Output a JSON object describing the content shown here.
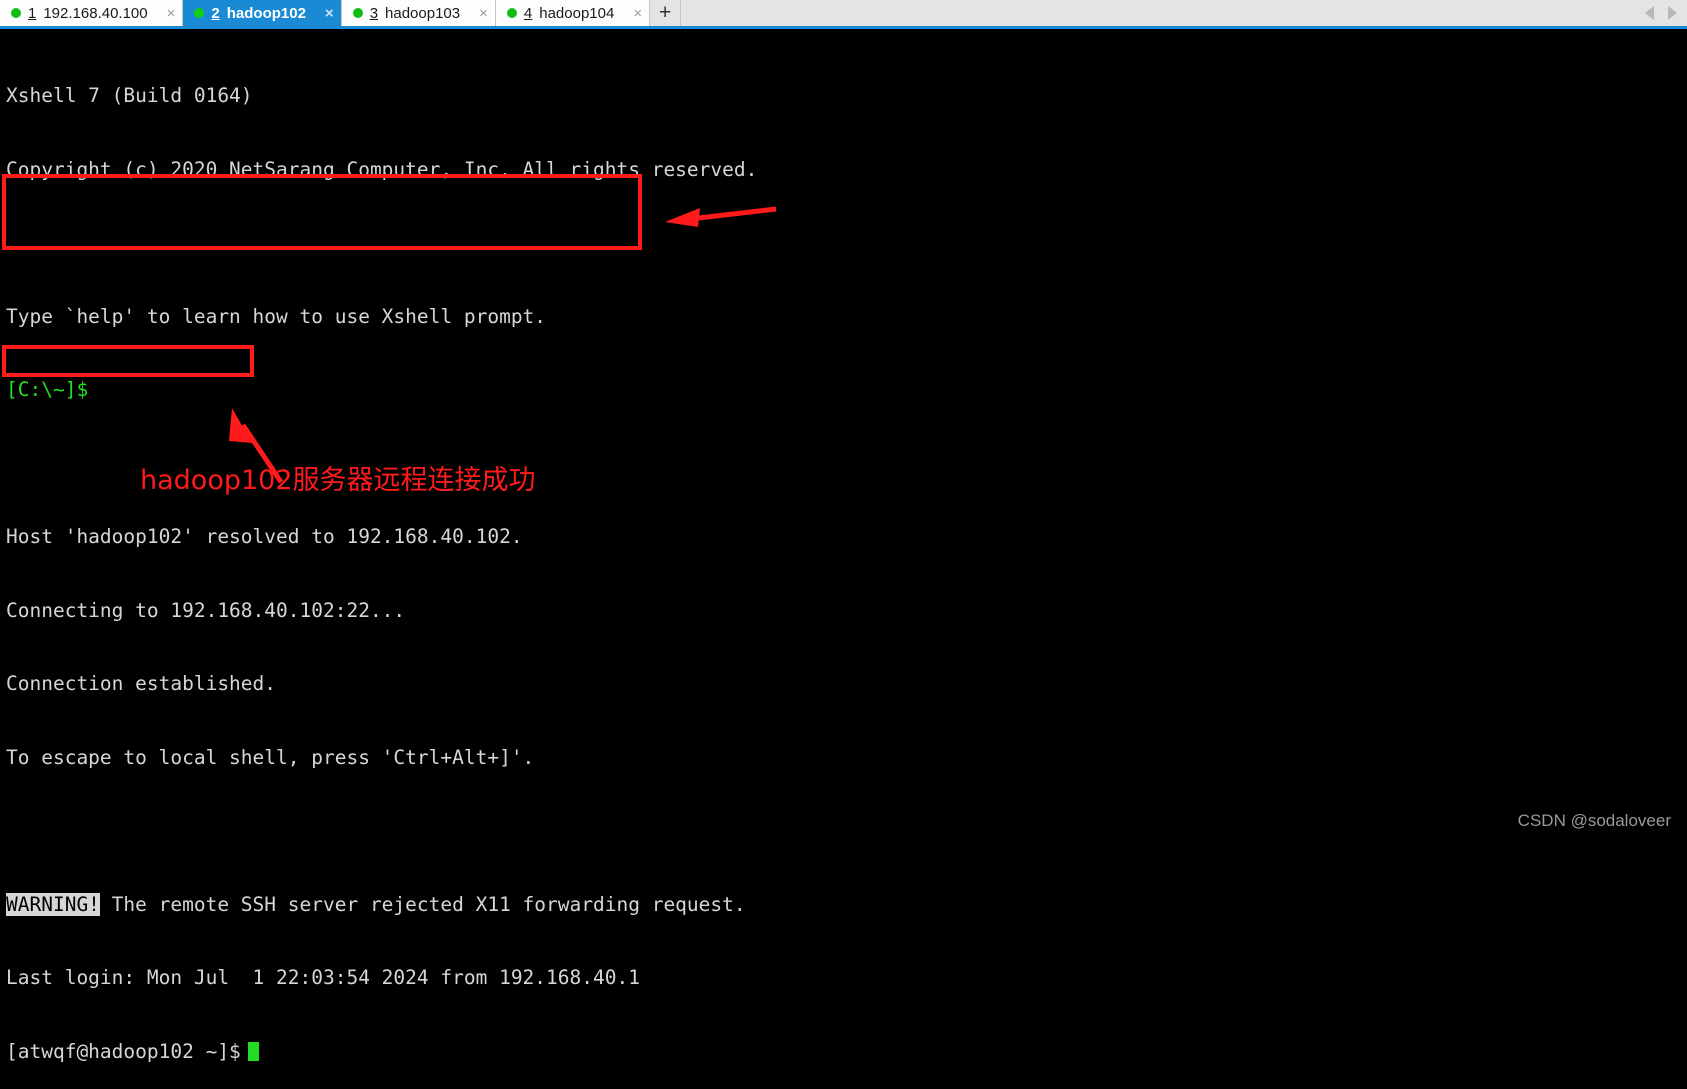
{
  "window": {
    "tabs": [
      {
        "index": "1",
        "label": "192.168.40.100",
        "active": false,
        "status": "connected",
        "close": "×"
      },
      {
        "index": "2",
        "label": "hadoop102",
        "active": true,
        "status": "connected",
        "close": "×"
      },
      {
        "index": "3",
        "label": "hadoop103",
        "active": false,
        "status": "connected",
        "close": "×"
      },
      {
        "index": "4",
        "label": "hadoop104",
        "active": false,
        "status": "connected",
        "close": "×"
      }
    ],
    "new_tab_label": "+",
    "scroll_left_icon": "chevron-left-icon",
    "scroll_right_icon": "chevron-right-icon"
  },
  "terminal": {
    "line_1": "Xshell 7 (Build 0164)",
    "line_2": "Copyright (c) 2020 NetSarang Computer, Inc. All rights reserved.",
    "line_3": "Type `help' to learn how to use Xshell prompt.",
    "line_4_prompt": "[C:\\~]$",
    "line_5": "Host 'hadoop102' resolved to 192.168.40.102.",
    "line_6": "Connecting to 192.168.40.102:22...",
    "line_7": "Connection established.",
    "line_8": "To escape to local shell, press 'Ctrl+Alt+]'.",
    "warning_tag": "WARNING!",
    "warning_text": " The remote SSH server rejected X11 forwarding request.",
    "line_10": "Last login: Mon Jul  1 22:03:54 2024 from 192.168.40.1",
    "shell_prompt": "[atwqf@hadoop102 ~]$"
  },
  "annotations": {
    "note_text": "hadoop102服务器远程连接成功",
    "color": "#ff1b1b",
    "arrow_to_connection": "left-arrow-icon",
    "arrow_to_prompt": "up-left-arrow-icon"
  },
  "watermark": {
    "text": "CSDN @sodaloveer"
  },
  "colors": {
    "active_tab": "#1a8ad4",
    "status_dot": "#10bd10",
    "terminal_bg": "#000000",
    "terminal_fg": "#d6d6d6",
    "prompt_green": "#22e022",
    "annotation_red": "#ff1b1b"
  }
}
